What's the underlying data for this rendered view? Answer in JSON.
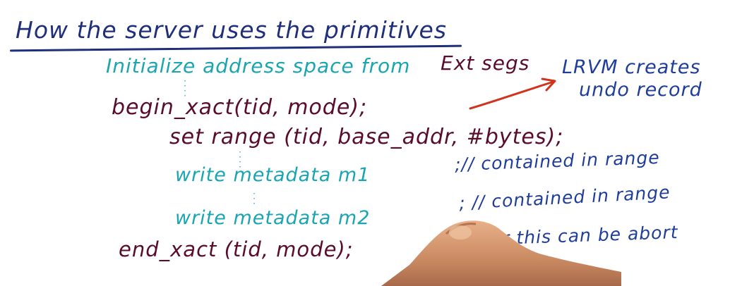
{
  "board": {
    "title": "How the server uses the primitives",
    "init_line": "Initialize address space from",
    "init_ext": "Ext segs",
    "begin_line": "begin_xact(tid, mode);",
    "set_range_line": "set range (tid, base_addr, #bytes);",
    "write1_line": "write metadata m1",
    "write2_line": "write metadata m2",
    "end_line": "end_xact (tid, mode);",
    "comment1": ";// contained in range",
    "comment2": "; // contained in range",
    "comment3": "//or this can be abort",
    "lrvm_line1": "LRVM creates",
    "lrvm_line2": "undo record"
  },
  "colors": {
    "title_ink": "#1f2f7a",
    "code_teal": "#1aa6b0",
    "code_maroon": "#5a0c2a",
    "comment_blue": "#1f3d9a",
    "arrow_red": "#d0341c",
    "background": "#ffffff"
  }
}
